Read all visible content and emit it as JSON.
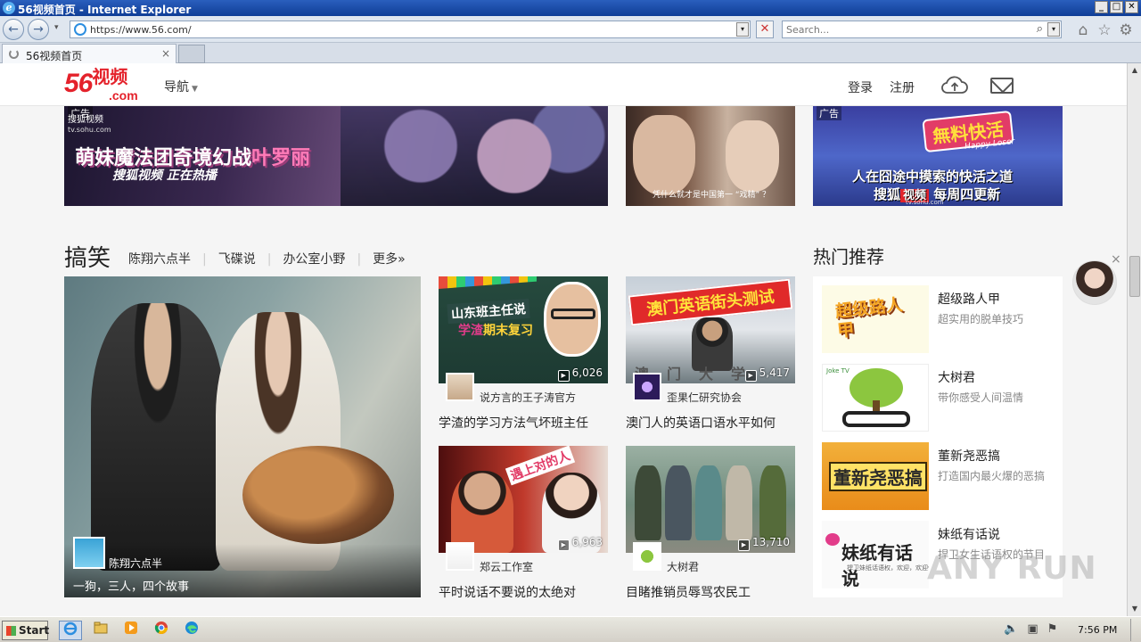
{
  "window": {
    "title": "56视频首页 - Internet Explorer",
    "minimize": "_",
    "maximize": "□",
    "close": "✕"
  },
  "toolbar": {
    "back_glyph": "←",
    "forward_glyph": "→",
    "dropdown_glyph": "▾",
    "address": "https://www.56.com/",
    "stop_glyph": "✕",
    "search_placeholder": "Search...",
    "search_glyph": "⌕",
    "home_glyph": "⌂",
    "favorites_glyph": "☆",
    "tools_glyph": "⚙"
  },
  "tab": {
    "label": "56视频首页",
    "close_glyph": "×"
  },
  "site": {
    "logo_num": "56",
    "logo_name": "视频",
    "logo_domain": ".com",
    "nav_label": "导航",
    "nav_caret": "▼",
    "login": "登录",
    "register": "注册"
  },
  "banners": {
    "ad_tag": "广告",
    "b1_brand": "搜狐视频",
    "b1_url": "tv.sohu.com",
    "b1_headline": "萌妹魔法团奇境幻战",
    "b1_pink": "叶罗丽",
    "b1_sub": "搜狐视频 正在热播",
    "b2_caption": "凭什么就才是中国第一 “戏精” ？",
    "b3_logo": "無料快活",
    "b3_logo_sub": "Happy Loser",
    "b3_tagline": "人在囧途中摸索的快活之道",
    "b3_brand": "搜狐",
    "b3_brand_red": "视频",
    "b3_schedule": "每周四更新",
    "b3_url": "tv.sohu.com"
  },
  "section": {
    "title": "搞笑",
    "tabs": [
      "陈翔六点半",
      "飞碟说",
      "办公室小野",
      "更多»"
    ]
  },
  "feature": {
    "author": "陈翔六点半",
    "caption": "一狗，三人，四个故事"
  },
  "cards": [
    {
      "views": "6,026",
      "author": "说方言的王子涛官方",
      "title": "学渣的学习方法气坏班主任",
      "thumb_text": "山东班主任说",
      "thumb_sub1": "学渣",
      "thumb_sub2": "期末复习"
    },
    {
      "views": "5,417",
      "author": "歪果仁研究协会",
      "title": "澳门人的英语口语水平如何",
      "thumb_text": "澳门英语街头测试",
      "thumb_sub1": "澳门大学"
    },
    {
      "views": "6,963",
      "author": "郑云工作室",
      "title": "平时说话不要说的太绝对",
      "thumb_text": "遇上对的人"
    },
    {
      "views": "13,710",
      "author": "大树君",
      "title": "目睹推销员辱骂农民工"
    }
  ],
  "play_glyph": "▶",
  "sidebar": {
    "title": "热门推荐",
    "items": [
      {
        "name": "超级路人甲",
        "desc": "超实用的脱单技巧",
        "thumb_text": "超级路人甲"
      },
      {
        "name": "大树君",
        "desc": "带你感受人间温情",
        "thumb_text": "Joke TV"
      },
      {
        "name": "董新尧恶搞",
        "desc": "打造国内最火爆的恶搞",
        "thumb_text": "董新尧恶搞"
      },
      {
        "name": "妹纸有话说",
        "desc": "捍卫女生话语权的节目",
        "thumb_text": "妹纸有话说",
        "thumb_sub": "捍卫妹纸话语权，欢迎，欢迎你哦！"
      }
    ]
  },
  "float_close": "×",
  "watermark": "ANY RUN",
  "taskbar": {
    "start": "Start",
    "clock": "7:56 PM"
  },
  "colors": {
    "brand_red": "#e4222b",
    "titlebar": "#0f3d96",
    "page_bg": "#f5f5f5"
  },
  "icons": [
    "ie-logo-icon",
    "back-icon",
    "forward-icon",
    "stop-icon",
    "search-icon",
    "home-icon",
    "favorites-icon",
    "tools-icon",
    "cloud-upload-icon",
    "mail-icon",
    "play-icon",
    "close-icon"
  ]
}
